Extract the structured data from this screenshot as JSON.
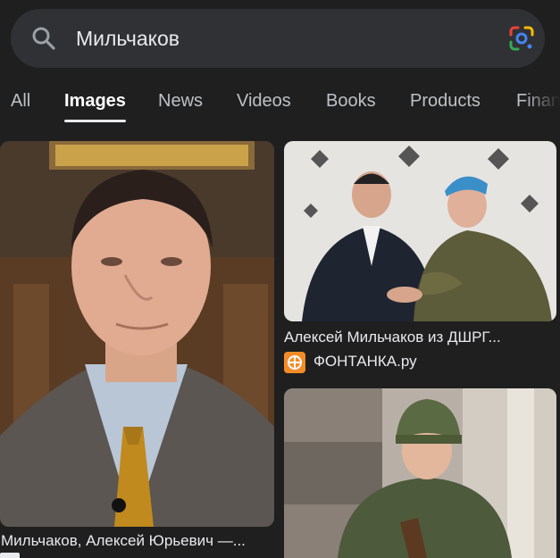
{
  "search": {
    "query": "Мильчаков"
  },
  "icons": {
    "search": "search-icon",
    "lens": "google-lens-icon",
    "source": "fontanka-favicon-icon"
  },
  "tabs": [
    {
      "label": "All"
    },
    {
      "label": "Images",
      "active": true
    },
    {
      "label": "News"
    },
    {
      "label": "Videos"
    },
    {
      "label": "Books"
    },
    {
      "label": "Products"
    },
    {
      "label": "Finan"
    }
  ],
  "results": [
    {
      "caption": "Мильчаков, Алексей Юрьевич —..."
    },
    {
      "caption": "Алексей Мильчаков из ДШРГ...",
      "source": "ФОНТАНКА.ру"
    },
    {
      "caption": ""
    }
  ],
  "colors": {
    "background": "#1f1f1f",
    "search_bar": "#303134",
    "text": "#e8eaed",
    "tab_inactive": "#bdc1c6"
  }
}
